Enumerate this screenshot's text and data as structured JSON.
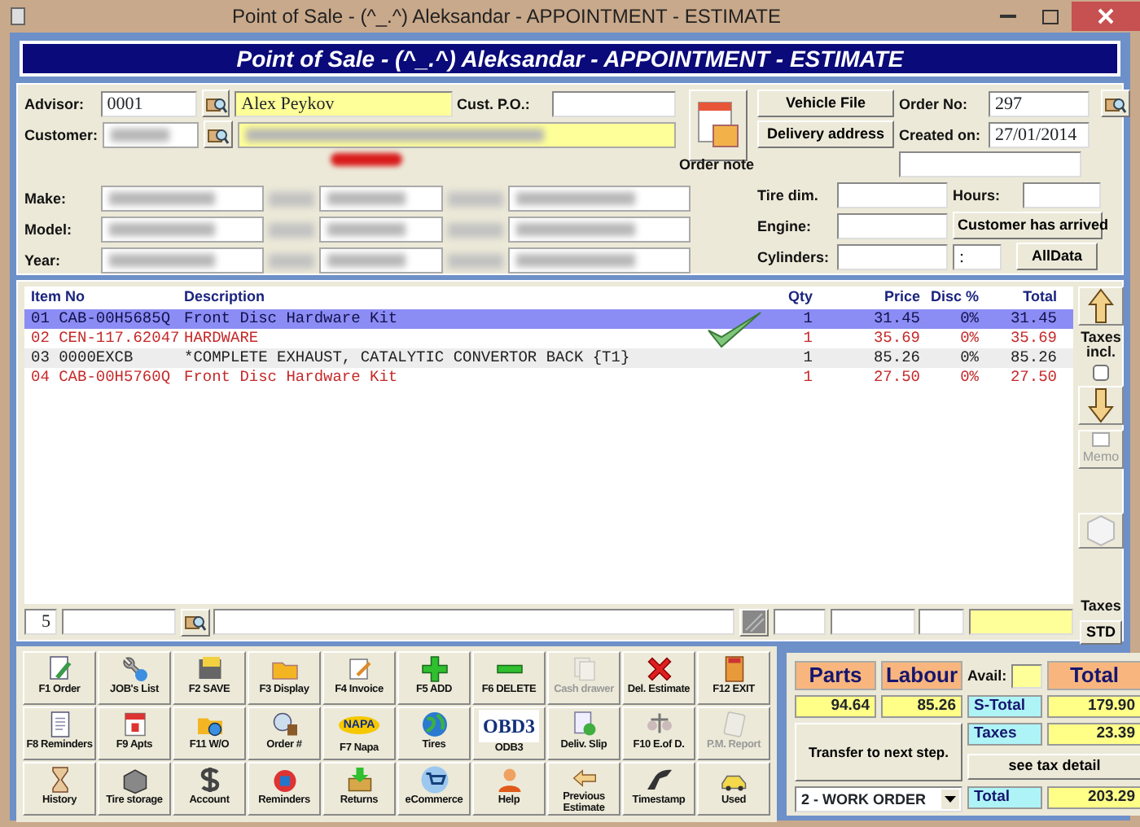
{
  "window": {
    "title": "Point of Sale - (^_.^) Aleksandar - APPOINTMENT - ESTIMATE"
  },
  "header": {
    "title": "Point of Sale - (^_.^) Aleksandar - APPOINTMENT - ESTIMATE"
  },
  "form": {
    "advisor": {
      "label": "Advisor:",
      "code": "0001",
      "name": "Alex Peykov"
    },
    "customer": {
      "label": "Customer:"
    },
    "cust_po": {
      "label": "Cust. P.O.:"
    },
    "vehicle_labels": [
      "Make:",
      "Model:",
      "Year:"
    ],
    "vehicle_file": "Vehicle File",
    "delivery_address": "Delivery address",
    "order_no": {
      "label": "Order No:",
      "value": "297"
    },
    "created_on": {
      "label": "Created on:",
      "value": "27/01/2014"
    },
    "order_note": {
      "label": "Order note"
    },
    "tire_dim": {
      "label": "Tire dim."
    },
    "hours": {
      "label": "Hours:"
    },
    "engine": {
      "label": "Engine:"
    },
    "customer_arrived": "Customer has arrived",
    "cylinders": {
      "label": "Cylinders:"
    },
    "time_field": {
      "value": ":"
    },
    "alldata": "AllData"
  },
  "table": {
    "columns": [
      "Item No",
      "Description",
      "Qty",
      "Price",
      "Disc %",
      "Total"
    ],
    "rows": [
      {
        "item_no": "01 CAB-00H5685Q",
        "description": "Front Disc Hardware Kit",
        "qty": "1",
        "price": "31.45",
        "disc": "0%",
        "total": "31.45",
        "kind": "part",
        "selected": true
      },
      {
        "item_no": "02 CEN-117.62047",
        "description": "HARDWARE",
        "qty": "1",
        "price": "35.69",
        "disc": "0%",
        "total": "35.69",
        "kind": "part",
        "selected": false
      },
      {
        "item_no": "03 0000EXCB",
        "description": "*COMPLETE EXHAUST, CATALYTIC CONVERTOR BACK {T1}",
        "qty": "1",
        "price": "85.26",
        "disc": "0%",
        "total": "85.26",
        "kind": "labour",
        "selected": false
      },
      {
        "item_no": "04 CAB-00H5760Q",
        "description": "Front Disc Hardware Kit",
        "qty": "1",
        "price": "27.50",
        "disc": "0%",
        "total": "27.50",
        "kind": "part",
        "selected": false
      }
    ]
  },
  "side": {
    "taxes_incl": {
      "label": "Taxes incl.",
      "checked": false
    },
    "memo": {
      "label": "Memo",
      "disabled": true
    },
    "taxes_label": "Taxes",
    "std": "STD"
  },
  "entry_bar": {
    "line": "5"
  },
  "toolbar": {
    "buttons": [
      {
        "label": "F1 Order",
        "disabled": false
      },
      {
        "label": "JOB's List",
        "disabled": false
      },
      {
        "label": "F2 SAVE",
        "disabled": false
      },
      {
        "label": "F3 Display",
        "disabled": false
      },
      {
        "label": "F4 Invoice",
        "disabled": false
      },
      {
        "label": "F5 ADD",
        "disabled": false
      },
      {
        "label": "F6 DELETE",
        "disabled": false
      },
      {
        "label": "Cash drawer",
        "disabled": true
      },
      {
        "label": "Del. Estimate",
        "disabled": false
      },
      {
        "label": "F12 EXIT",
        "disabled": false
      },
      {
        "label": "F8 Reminders",
        "disabled": false
      },
      {
        "label": "F9 Apts",
        "disabled": false
      },
      {
        "label": "F11 W/O",
        "disabled": false
      },
      {
        "label": "Order #",
        "disabled": false
      },
      {
        "label": "F7 Napa",
        "disabled": false,
        "logo_text": "NAPA"
      },
      {
        "label": "Tires",
        "disabled": false
      },
      {
        "label": "ODB3",
        "disabled": false,
        "logo_text": "OBD3"
      },
      {
        "label": "Deliv. Slip",
        "disabled": false
      },
      {
        "label": "F10 E.of D.",
        "disabled": false
      },
      {
        "label": "P.M. Report",
        "disabled": true
      },
      {
        "label": "History",
        "disabled": false
      },
      {
        "label": "Tire storage",
        "disabled": false
      },
      {
        "label": "Account",
        "disabled": false
      },
      {
        "label": "Reminders",
        "disabled": false
      },
      {
        "label": "Returns",
        "disabled": false
      },
      {
        "label": "eCommerce",
        "disabled": false
      },
      {
        "label": "Help",
        "disabled": false
      },
      {
        "label": "Previous Estimate",
        "disabled": false
      },
      {
        "label": "Timestamp",
        "disabled": false
      },
      {
        "label": "Used",
        "disabled": false
      }
    ]
  },
  "summary": {
    "parts": {
      "label": "Parts",
      "value": "94.64"
    },
    "labour": {
      "label": "Labour",
      "value": "85.26"
    },
    "avail_label": "Avail:",
    "total_header": "Total",
    "s_total": {
      "label": "S-Total",
      "value": "179.90"
    },
    "taxes": {
      "label": "Taxes",
      "value": "23.39"
    },
    "tax_detail": "see tax detail",
    "transfer": "Transfer to next step.",
    "step": "2 - WORK ORDER",
    "total": {
      "label": "Total",
      "value": "203.29"
    }
  }
}
